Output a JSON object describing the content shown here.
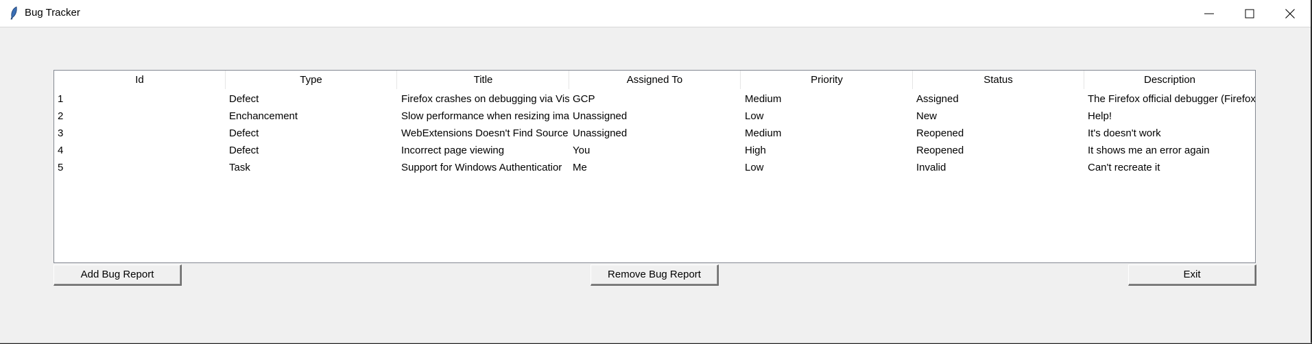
{
  "window": {
    "title": "Bug Tracker",
    "controls": [
      "minimize",
      "maximize",
      "close"
    ]
  },
  "table": {
    "columns": [
      "Id",
      "Type",
      "Title",
      "Assigned To",
      "Priority",
      "Status",
      "Description"
    ],
    "rows": [
      [
        "1",
        "Defect",
        "Firefox crashes on debugging via Vis",
        "GCP",
        "Medium",
        "Assigned",
        "The Firefox official debugger (Firefox"
      ],
      [
        "2",
        "Enchancement",
        "Slow performance when resizing ima",
        "Unassigned",
        "Low",
        "New",
        "Help!"
      ],
      [
        "3",
        "Defect",
        "WebExtensions Doesn't Find Source",
        "Unassigned",
        "Medium",
        "Reopened",
        "It's doesn't work"
      ],
      [
        "4",
        "Defect",
        "Incorrect page viewing",
        "You",
        "High",
        "Reopened",
        "It shows me an error again"
      ],
      [
        "5",
        "Task",
        "Support for Windows Authenticatior",
        "Me",
        "Low",
        "Invalid",
        "Can't recreate it"
      ]
    ]
  },
  "buttons": {
    "add": "Add Bug Report",
    "remove": "Remove Bug Report",
    "exit": "Exit"
  }
}
